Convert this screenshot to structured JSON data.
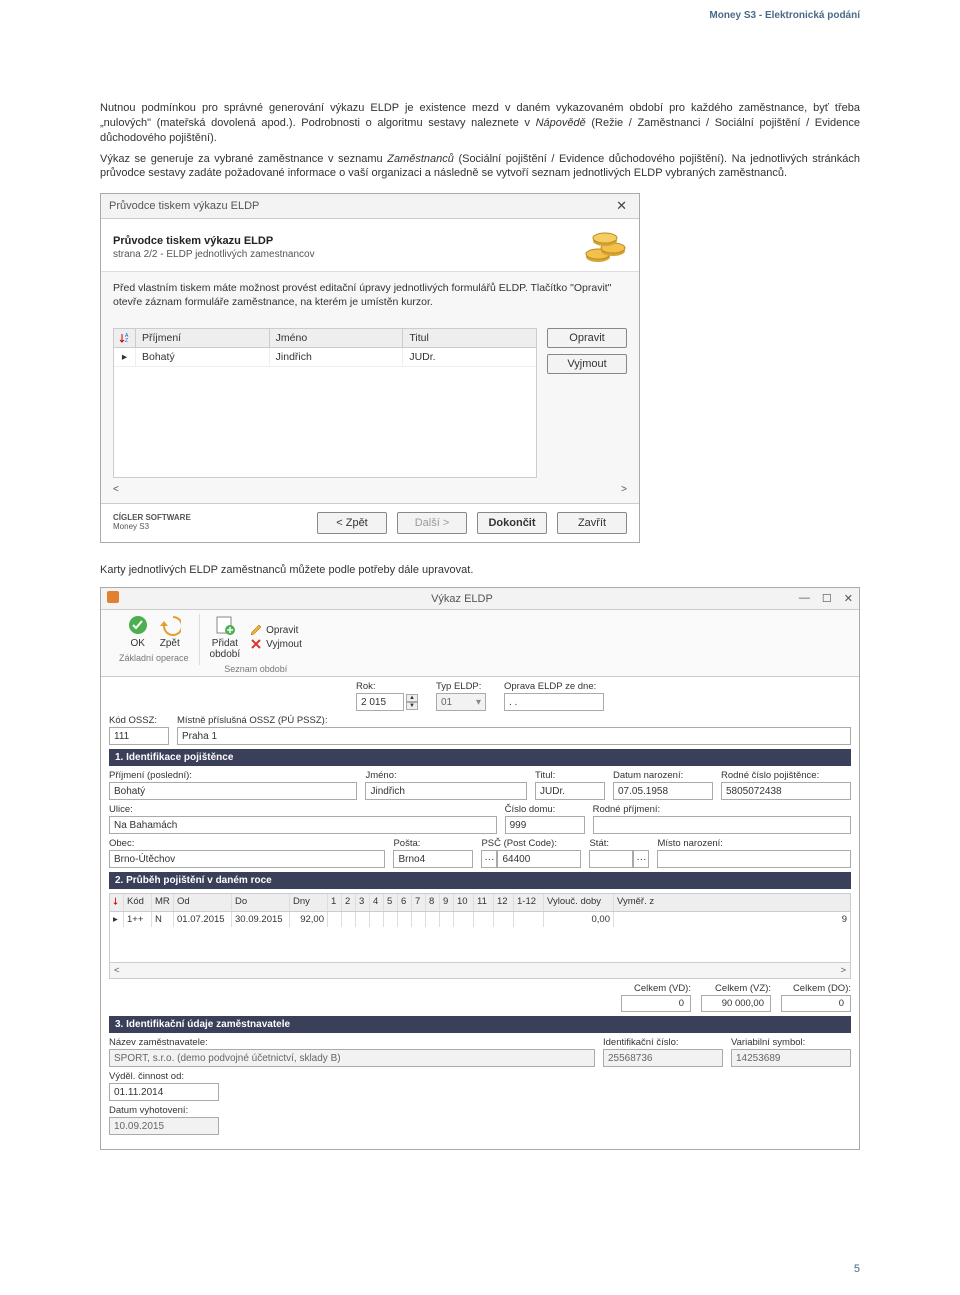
{
  "doc": {
    "header": "Money S3 - Elektronická podání",
    "p1": "Nutnou podmínkou pro správné generování výkazu ELDP je existence mezd v daném vykazovaném období pro každého zaměstnance, byť třeba „nulových\" (mateřská dovolená apod.). Podrobnosti o algoritmu sestavy naleznete v ",
    "p1_em": "Nápovědě",
    "p1b": " (Režie / Zaměstnanci / Sociální pojištění / Evidence důchodového pojištění).",
    "p2a": "Výkaz se generuje za vybrané zaměstnance v seznamu ",
    "p2_em": "Zaměstnanců",
    "p2b": " (Sociální pojištění / Evidence důchodového pojištění). Na jednotlivých stránkách průvodce sestavy zadáte požadované informace o vaší organizaci a následně se vytvoří seznam jednotlivých ELDP vybraných zaměstnanců.",
    "caption2": "Karty jednotlivých ELDP zaměstnanců můžete podle potřeby dále upravovat.",
    "page_num": "5"
  },
  "wizard": {
    "win_title": "Průvodce tiskem výkazu ELDP",
    "title": "Průvodce tiskem výkazu ELDP",
    "subtitle": "strana 2/2 - ELDP jednotlivých zamestnancov",
    "intro": "Před vlastním tiskem máte možnost provést editační úpravy jednotlivých formulářů ELDP. Tlačítko \"Opravit\" otevře záznam formuláře zaměstnance, na kterém je umístěn kurzor.",
    "cols": {
      "c1": "Příjmení",
      "c2": "Jméno",
      "c3": "Titul"
    },
    "row": {
      "c1": "Bohatý",
      "c2": "Jindřich",
      "c3": "JUDr."
    },
    "side": {
      "edit": "Opravit",
      "remove": "Vyjmout"
    },
    "brand1": "CÍGLER SOFTWARE",
    "brand2": "Money S3",
    "nav": {
      "back": "< Zpět",
      "next": "Další >",
      "finish": "Dokončit",
      "close": "Zavřít"
    },
    "scroll_left": "<",
    "scroll_right": ">"
  },
  "eldp": {
    "title": "Výkaz ELDP",
    "sys": {
      "min": "—",
      "max": "☐",
      "close": "✕"
    },
    "ribbon": {
      "ok": "OK",
      "back": "Zpět",
      "add": "Přidat\nobdobí",
      "edit": "Opravit",
      "remove": "Vyjmout",
      "g1": "Základní operace",
      "g2": "Seznam období"
    },
    "top": {
      "rok_l": "Rok:",
      "rok_v": "2 015",
      "typ_l": "Typ ELDP:",
      "typ_v": "01",
      "oprava_l": "Oprava ELDP ze dne:",
      "oprava_v": ".  ."
    },
    "ossz": {
      "kod_l": "Kód OSSZ:",
      "kod_v": "111",
      "prisl_l": "Místně příslušná OSSZ (PÚ PSSZ):",
      "prisl_v": "Praha 1"
    },
    "sec1": "1. Identifikace pojištěnce",
    "id": {
      "prijmeni_l": "Příjmení (poslední):",
      "prijmeni_v": "Bohatý",
      "jmeno_l": "Jméno:",
      "jmeno_v": "Jindřich",
      "titul_l": "Titul:",
      "titul_v": "JUDr.",
      "narozeni_l": "Datum narození:",
      "narozeni_v": "07.05.1958",
      "rc_l": "Rodné číslo pojištěnce:",
      "rc_v": "5805072438",
      "ulice_l": "Ulice:",
      "ulice_v": "Na Bahamách",
      "cislo_l": "Číslo domu:",
      "cislo_v": "999",
      "rodne_l": "Rodné příjmení:",
      "rodne_v": "",
      "obec_l": "Obec:",
      "obec_v": "Brno-Útěchov",
      "posta_l": "Pošta:",
      "posta_v": "Brno4",
      "psc_l": "PSČ (Post Code):",
      "psc_v": "64400",
      "stat_l": "Stát:",
      "stat_v": "",
      "misto_l": "Místo narození:",
      "misto_v": ""
    },
    "sec2": "2. Průběh pojištění v daném roce",
    "tbl": {
      "heads": [
        "Kód",
        "MR",
        "Od",
        "Do",
        "Dny",
        "1",
        "2",
        "3",
        "4",
        "5",
        "6",
        "7",
        "8",
        "9",
        "10",
        "11",
        "12",
        "1-12",
        "Vylouč. doby",
        "Vyměř. z"
      ],
      "row": {
        "mark": "▸",
        "kod": "1++",
        "mr": "N",
        "od": "01.07.2015",
        "do": "30.09.2015",
        "dny": "92,00",
        "vylouc": "0,00",
        "vymer": "9"
      }
    },
    "totals": {
      "vd_l": "Celkem (VD):",
      "vd_v": "0",
      "vz_l": "Celkem (VZ):",
      "vz_v": "90 000,00",
      "do_l": "Celkem (DO):",
      "do_v": "0"
    },
    "sec3": "3. Identifikační údaje zaměstnavatele",
    "emp": {
      "nazev_l": "Název zaměstnavatele:",
      "nazev_v": "SPORT, s.r.o. (demo podvojné účetnictví, sklady B)",
      "ic_l": "Identifikační číslo:",
      "ic_v": "25568736",
      "vs_l": "Variabilní symbol:",
      "vs_v": "14253689",
      "cinnost_l": "Výděl. činnost od:",
      "cinnost_v": "01.11.2014",
      "vyhot_l": "Datum vyhotovení:",
      "vyhot_v": "10.09.2015"
    }
  }
}
